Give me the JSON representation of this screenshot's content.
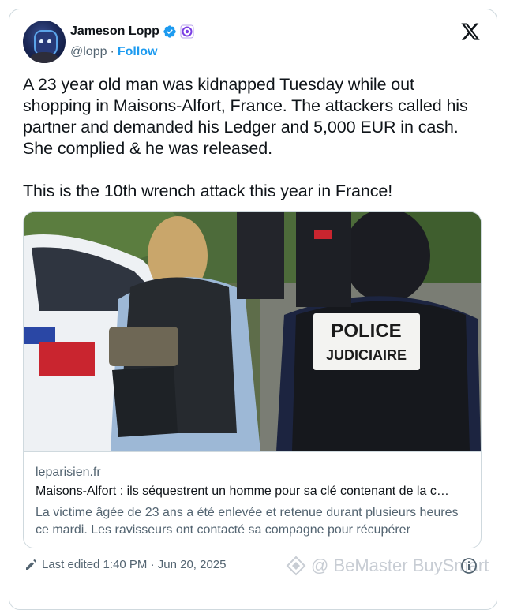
{
  "author": {
    "display_name": "Jameson Lopp",
    "handle": "@lopp",
    "separator": "·",
    "follow_label": "Follow",
    "verified_color": "#1d9bf0",
    "affiliate_color": "#7b3fe4"
  },
  "tweet": {
    "text": "A 23 year old man was kidnapped Tuesday while out shopping in Maisons-Alfort, France. The attackers called his partner and demanded his Ledger and 5,000 EUR in cash. She complied & he was released.\n\nThis is the 10th wrench attack this year in France!"
  },
  "link_card": {
    "domain": "leparisien.fr",
    "title": "Maisons-Alfort : ils séquestrent un homme pour sa clé contenant de la c…",
    "description": "La victime âgée de 23 ans a été enlevée et retenue durant plusieurs heures ce mardi. Les ravisseurs ont contacté sa compagne pour récupérer",
    "image_vest_line1": "POLICE",
    "image_vest_line2": "JUDICIAIRE"
  },
  "footer": {
    "edited_label": "Last edited 1:40 PM · Jun 20, 2025"
  },
  "watermark": {
    "text": "@ BeMaster BuySmart"
  },
  "colors": {
    "text_primary": "#0f1419",
    "text_secondary": "#536471",
    "accent": "#1d9bf0",
    "border": "#cfd9de"
  },
  "icons": [
    "verified-badge-icon",
    "affiliate-badge-icon",
    "x-logo-icon",
    "pencil-icon",
    "info-icon",
    "bemaster-logo-icon"
  ]
}
